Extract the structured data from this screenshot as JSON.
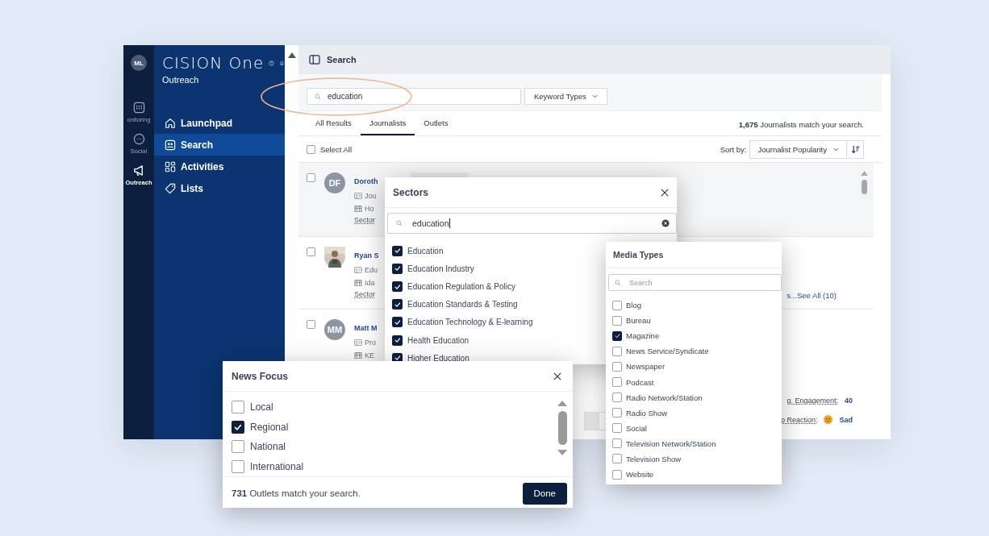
{
  "rail": {
    "avatar": "ML",
    "items": [
      {
        "kind": "monitoring",
        "label": "onitoring",
        "selected": false
      },
      {
        "kind": "social",
        "label": "Social",
        "selected": false
      },
      {
        "kind": "outreach",
        "label": "Outreach",
        "selected": true
      }
    ]
  },
  "brand": {
    "name": "CISION One",
    "product": "Outreach"
  },
  "nav": [
    {
      "kind": "home",
      "label": "Launchpad",
      "selected": false
    },
    {
      "kind": "search",
      "label": "Search",
      "selected": true
    },
    {
      "kind": "activities",
      "label": "Activities",
      "selected": false
    },
    {
      "kind": "lists",
      "label": "Lists",
      "selected": false
    }
  ],
  "header": {
    "title": "Search"
  },
  "search": {
    "value": "education",
    "keyword_button": "Keyword Types"
  },
  "tabs": [
    {
      "label": "All Results",
      "selected": false
    },
    {
      "label": "Journalists",
      "selected": true
    },
    {
      "label": "Outlets",
      "selected": false
    }
  ],
  "match_count": "**1,675** Journalists match your search.",
  "select_all": {
    "label": "Select All",
    "checked": false
  },
  "sort": {
    "label": "Sort by:",
    "value": "Journalist Popularity"
  },
  "results": [
    {
      "avatar": "DF",
      "kind": "initials",
      "name": "Doroth",
      "lines": [
        "Jou",
        "Ho"
      ],
      "sector": "Sector",
      "checked": false
    },
    {
      "name": "Ryan S",
      "lines": [
        "Edu",
        "Ida"
      ],
      "sector": "Sector",
      "checked": false,
      "see_all": "s...See All (10)"
    },
    {
      "avatar": "MM",
      "kind": "initials",
      "name": "Matt M",
      "lines": [
        "Pro",
        "KE"
      ],
      "checked": false,
      "stats": [
        {
          "label": "g. Engagement:",
          "value": "40"
        },
        {
          "label": "p Reaction:",
          "value": "Sad",
          "kind": "sad"
        }
      ]
    }
  ],
  "sectors": {
    "title": "Sectors",
    "search": "education",
    "items": [
      {
        "label": "Education",
        "checked": true
      },
      {
        "label": "Education Industry",
        "checked": true
      },
      {
        "label": "Education Regulation & Policy",
        "checked": true
      },
      {
        "label": "Education Standards & Testing",
        "checked": true
      },
      {
        "label": "Education Technology & E-learning",
        "checked": true
      },
      {
        "label": "Health Education",
        "checked": true
      },
      {
        "label": "Higher Education",
        "checked": true
      }
    ]
  },
  "media_types": {
    "title": "Media Types",
    "placeholder": "Search",
    "items": [
      {
        "label": "Blog",
        "checked": false
      },
      {
        "label": "Bureau",
        "checked": false
      },
      {
        "label": "Magazine",
        "checked": true
      },
      {
        "label": "News Service/Syndicate",
        "checked": false
      },
      {
        "label": "Newspaper",
        "checked": false
      },
      {
        "label": "Podcast",
        "checked": false
      },
      {
        "label": "Radio Network/Station",
        "checked": false
      },
      {
        "label": "Radio Show",
        "checked": false
      },
      {
        "label": "Social",
        "checked": false
      },
      {
        "label": "Television Network/Station",
        "checked": false
      },
      {
        "label": "Television Show",
        "checked": false
      },
      {
        "label": "Website",
        "checked": false
      }
    ]
  },
  "news_focus": {
    "title": "News Focus",
    "items": [
      {
        "label": "Local",
        "checked": false
      },
      {
        "label": "Regional",
        "checked": true
      },
      {
        "label": "National",
        "checked": false
      },
      {
        "label": "International",
        "checked": false
      }
    ],
    "count": "**731** Outlets match your search.",
    "done": "Done"
  }
}
